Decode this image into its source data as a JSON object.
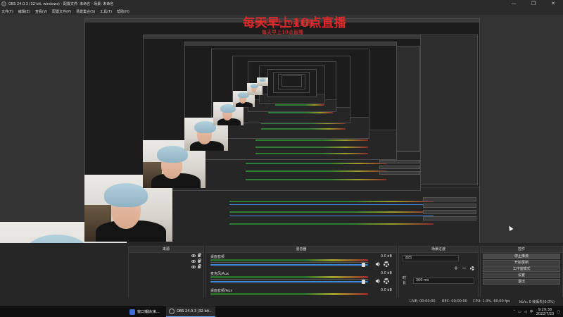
{
  "window": {
    "title": "OBS 24.0.3 (32-bit, windows) - 配置文件: 未命名 - 场景: 未命名",
    "controls": [
      "—",
      "❐",
      "✕"
    ]
  },
  "menu": [
    "文件(F)",
    "编辑(E)",
    "查看(V)",
    "配置文件(P)",
    "场景集合(S)",
    "工具(T)",
    "帮助(H)"
  ],
  "overlay": {
    "main": "每天早上10点直播",
    "echo1": "每天早上10点直播",
    "echo2": "每天早上10点直播"
  },
  "docks": {
    "sources": {
      "title": "来源"
    },
    "mixer": {
      "title": "混音器",
      "channels": [
        {
          "name": "桌面音频",
          "db": "0.0 dB",
          "volume": 0.97
        },
        {
          "name": "麦克风/Aux",
          "db": "0.0 dB",
          "volume": 0.97
        },
        {
          "name": "桌面音频/Aux",
          "db": "0.0 dB",
          "volume": 0.97
        }
      ]
    },
    "transitions": {
      "title": "场景过渡",
      "selected": "淡出",
      "add": "+",
      "remove": "−",
      "duration_label": "时长",
      "duration_value": "300 ms"
    },
    "controls": {
      "title": "控件",
      "buttons": [
        "停止推流",
        "开始录制",
        "工作室模式",
        "设置",
        "退出"
      ]
    }
  },
  "status": {
    "live": "LIVE: 00:00:00",
    "rec": "REC: 00:00:00",
    "cpu": "CPU: 1.0%, 60.00 fps",
    "kbps": "kb/s: 0 帧丢失(0.0%)"
  },
  "taskbar": {
    "items": [
      "窗口捕获(来...",
      "OBS 24.0.3 (32-bit..."
    ],
    "time": "9:29:38",
    "date": "2022/7/23",
    "ime": "中"
  },
  "colors": {
    "overlay_text": "#e0282b",
    "slider": "#3c8ad8",
    "meter_green": "#2c7a2c",
    "meter_yellow": "#b8b82a",
    "meter_red": "#a32a2a"
  }
}
